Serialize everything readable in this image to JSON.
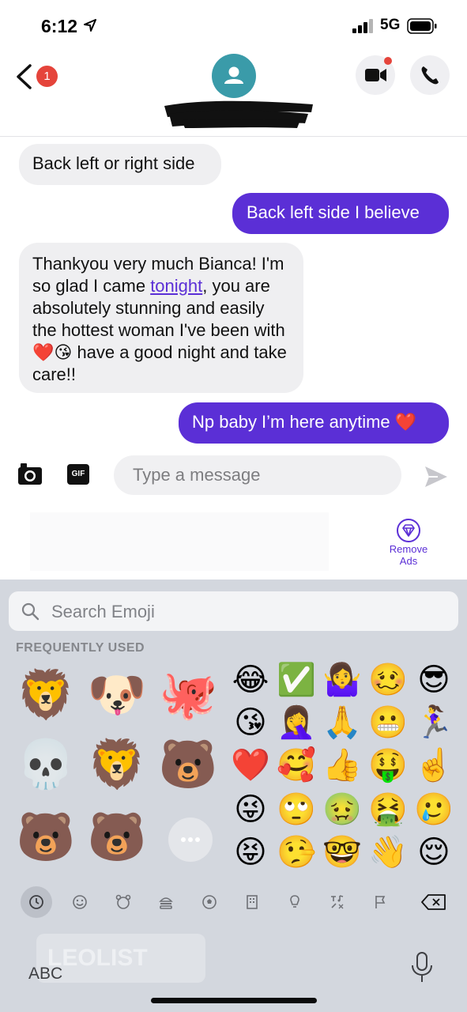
{
  "status_bar": {
    "time": "6:12",
    "network": "5G"
  },
  "header": {
    "back_badge_count": "1",
    "contact_name": ""
  },
  "messages": [
    {
      "side": "in",
      "text": "Back left or right side"
    },
    {
      "side": "out",
      "text": "Back left side I believe"
    },
    {
      "side": "in",
      "text_before": "Thankyou very much Bianca! I'm so glad I came ",
      "link": "tonight",
      "text_after": ", you are absolutely stunning and easily the hottest woman I've been with❤️😘 have a good night and take care!!"
    },
    {
      "side": "out",
      "text": "Np baby I’m here anytime ❤️"
    }
  ],
  "composer": {
    "gif_label": "GIF",
    "placeholder": "Type a message"
  },
  "ads": {
    "remove_label": "Remove Ads"
  },
  "keyboard": {
    "search_placeholder": "Search Emoji",
    "section_label": "FREQUENTLY USED",
    "memoji": [
      "🦁",
      "🐶",
      "🐙",
      "💀",
      "🦁",
      "🐻",
      "🐻",
      "🐻"
    ],
    "emoji_grid": [
      [
        "😂",
        "✅",
        "🤷‍♀️",
        "🥴",
        "😎"
      ],
      [
        "😘",
        "🤦‍♀️",
        "🙏",
        "😬",
        "🏃‍♀️"
      ],
      [
        "❤️",
        "🥰",
        "👍",
        "🤑",
        "☝️"
      ],
      [
        "😜",
        "🙄",
        "🤢",
        "🤮",
        "🥲"
      ],
      [
        "😝",
        "🤥",
        "🤓",
        "👋",
        "😌"
      ]
    ],
    "categories": [
      "recent",
      "smileys",
      "animals",
      "food",
      "activity",
      "travel",
      "objects",
      "symbols",
      "flags"
    ],
    "abc_label": "ABC",
    "ad_text": "LEOLIST"
  },
  "colors": {
    "accent": "#5b2fd6",
    "badge": "#e5443b",
    "avatar": "#3a9ba9"
  }
}
